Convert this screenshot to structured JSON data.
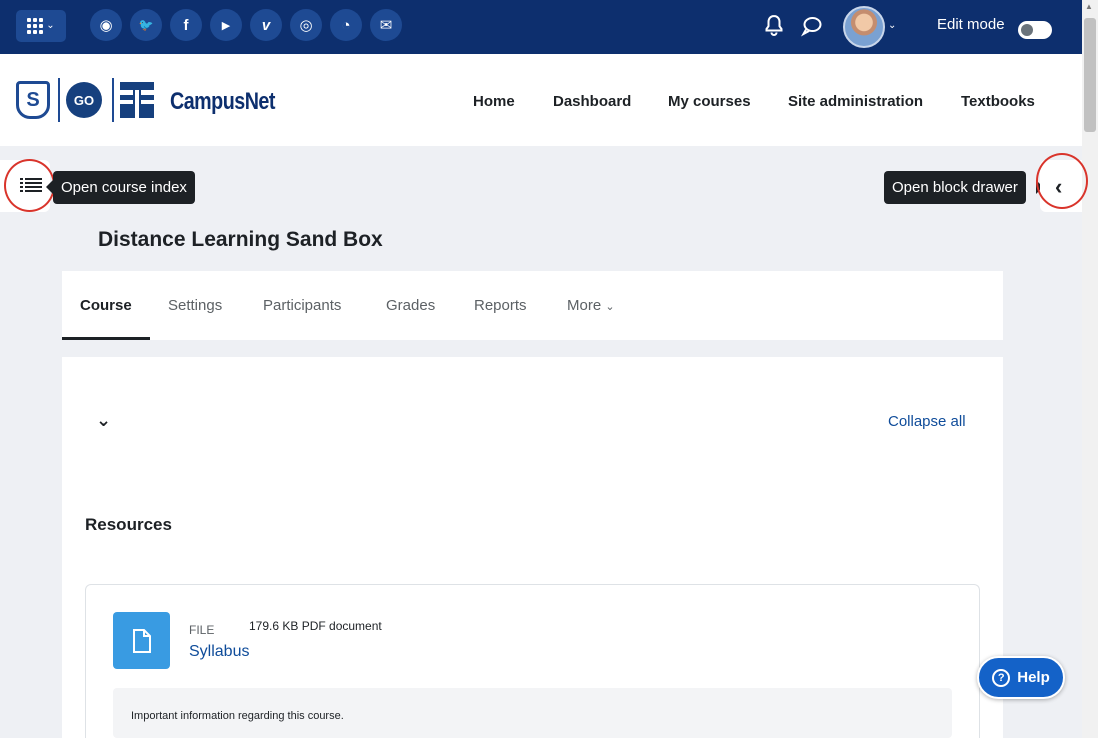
{
  "topbar": {
    "social_icons": [
      {
        "name": "globe-icon",
        "glyph": "◉"
      },
      {
        "name": "twitter-icon",
        "glyph": "🐦"
      },
      {
        "name": "facebook-icon",
        "glyph": "f"
      },
      {
        "name": "youtube-icon",
        "glyph": "▶"
      },
      {
        "name": "vimeo-icon",
        "glyph": "v"
      },
      {
        "name": "instagram-icon",
        "glyph": "◎"
      },
      {
        "name": "rss-icon",
        "glyph": "◔"
      },
      {
        "name": "email-icon",
        "glyph": "✉"
      }
    ],
    "edit_mode_label": "Edit mode",
    "edit_mode_on": false,
    "bg_color": "#0d2f6e"
  },
  "navbar": {
    "brand": "CampusNet",
    "logo_s": "S",
    "logo_go": "GO",
    "links": [
      "Home",
      "Dashboard",
      "My courses",
      "Site administration",
      "Textbooks"
    ]
  },
  "drawers": {
    "index_tooltip": "Open course index",
    "block_tooltip": "Open block drawer"
  },
  "course": {
    "title": "Distance Learning Sand Box",
    "tabs": [
      "Course",
      "Settings",
      "Participants",
      "Grades",
      "Reports",
      "More"
    ],
    "active_tab": "Course",
    "collapse_all": "Collapse all",
    "section_title": "Resources",
    "activity": {
      "type": "FILE",
      "meta": "179.6 KB PDF document",
      "name": "Syllabus",
      "description": "Important information regarding this course."
    }
  },
  "help": {
    "label": "Help",
    "glyph": "?"
  },
  "colors": {
    "link": "#0f4c9a",
    "file_icon": "#399be2",
    "help": "#1462c8",
    "highlight": "#d9342b"
  }
}
